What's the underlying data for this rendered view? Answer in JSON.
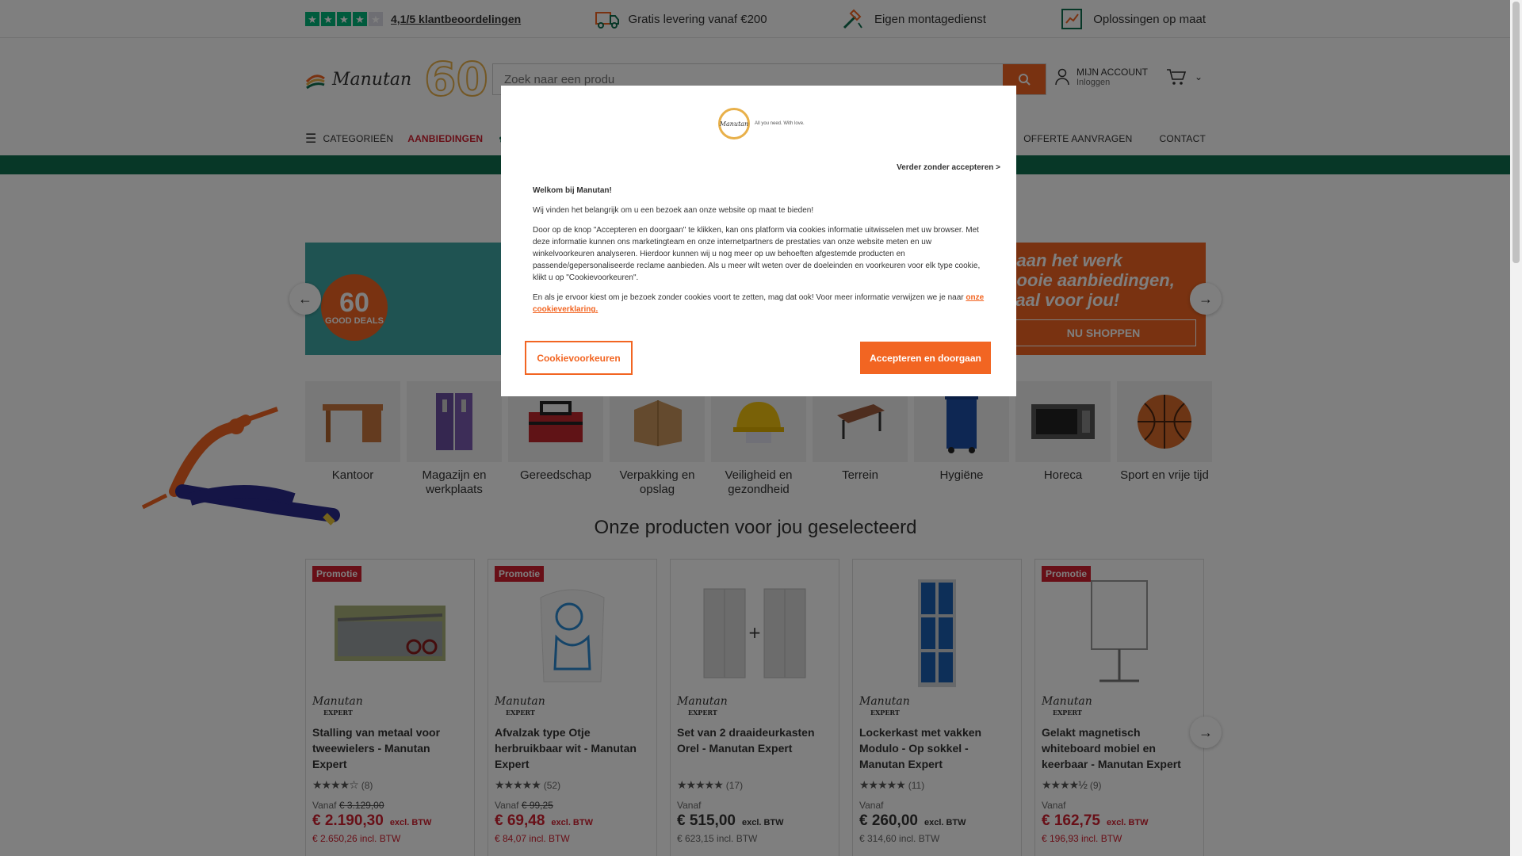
{
  "topbar": {
    "rating_text": "4,1/5 klantbeoordelingen",
    "rating_value": 4.1,
    "usp_delivery": "Gratis levering vanaf €200",
    "usp_assembly": "Eigen montagedienst",
    "usp_solutions": "Oplossingen op maat"
  },
  "header": {
    "logo_word": "Manutan",
    "logo_number": "60",
    "search_placeholder": "Zoek naar een produ",
    "account_label": "MIJN ACCOUNT",
    "account_sub": "Inloggen"
  },
  "nav": {
    "categories": "CATEGORIEËN",
    "offers": "AANBIEDINGEN",
    "quote": "OFFERTE AANVRAGEN",
    "contact": "CONTACT"
  },
  "hero": {
    "badge_number": "60",
    "badge_text": "GOOD DEALS",
    "title_line1": "g aan het werk",
    "title_line2": "mooie aanbiedingen,",
    "title_line3": "ciaal voor jou!",
    "cta": "NU SHOPPEN"
  },
  "categories": [
    {
      "label": "Kantoor",
      "icon": "desk-icon"
    },
    {
      "label": "Magazijn en werkplaats",
      "icon": "locker-icon"
    },
    {
      "label": "Gereedschap",
      "icon": "toolbox-icon"
    },
    {
      "label": "Verpakking en opslag",
      "icon": "box-icon"
    },
    {
      "label": "Veiligheid en gezondheid",
      "icon": "helmet-icon"
    },
    {
      "label": "Terrein",
      "icon": "bench-icon"
    },
    {
      "label": "Hygiëne",
      "icon": "bin-icon"
    },
    {
      "label": "Horeca",
      "icon": "microwave-icon"
    },
    {
      "label": "Sport en vrije tijd",
      "icon": "basketball-icon"
    }
  ],
  "section_title": "Onze producten voor jou geselecteerd",
  "products": [
    {
      "promo": "Promotie",
      "brand": "Manutan",
      "brand_sub": "EXPERT",
      "name": "Stalling van metaal voor tweewielers - Manutan Expert",
      "stars": 4,
      "reviews": "(8)",
      "vanaf": "Vanaf",
      "old_price": "€ 3.129,00",
      "price": "€ 2.190,30",
      "excl": "excl. BTW",
      "incl": "€ 2.650,26 incl. BTW"
    },
    {
      "promo": "Promotie",
      "brand": "Manutan",
      "brand_sub": "EXPERT",
      "name": "Afvalzak type Otje herbruikbaar wit - Manutan Expert",
      "stars": 5,
      "reviews": "(52)",
      "vanaf": "Vanaf",
      "old_price": "€ 99,25",
      "price": "€ 69,48",
      "excl": "excl. BTW",
      "incl": "€ 84,07 incl. BTW"
    },
    {
      "promo": "",
      "brand": "Manutan",
      "brand_sub": "EXPERT",
      "name": "Set van 2 draaideurkasten Orel - Manutan Expert",
      "stars": 5,
      "reviews": "(17)",
      "vanaf": "Vanaf",
      "old_price": "",
      "price": "€ 515,00",
      "excl": "excl. BTW",
      "incl": "€ 623,15 incl. BTW"
    },
    {
      "promo": "",
      "brand": "Manutan",
      "brand_sub": "EXPERT",
      "name": "Lockerkast met vakken Modulo - Op sokkel - Manutan Expert",
      "stars": 5,
      "reviews": "(11)",
      "vanaf": "Vanaf",
      "old_price": "",
      "price": "€ 260,00",
      "excl": "excl. BTW",
      "incl": "€ 314,60 incl. BTW"
    },
    {
      "promo": "Promotie",
      "brand": "Manutan",
      "brand_sub": "EXPERT",
      "name": "Gelakt magnetisch whiteboard mobiel en keerbaar - Manutan Expert",
      "stars": 4.5,
      "reviews": "(9)",
      "vanaf": "Vanaf",
      "old_price": "",
      "price": "€ 162,75",
      "excl": "excl. BTW",
      "incl": "€ 196,93 incl. BTW"
    }
  ],
  "cookie_modal": {
    "logo_word": "Manutan",
    "logo_tag": "All you need. With love.",
    "skip": "Verder zonder accepteren >",
    "welcome": "Welkom bij Manutan!",
    "p1": "Wij vinden het belangrijk om u een bezoek aan onze website op maat te bieden!",
    "p2": "Door op de knop \"Accepteren en doorgaan\" te klikken, kan ons platform via cookies informatie uitwisselen met uw browser. Met deze informatie kunnen ons marketingteam en onze internetpartners de prestaties van onze website meten en uw winkelvoorkeuren analyseren. Hierdoor kunnen wij u nog meer op uw behoeften afgestemde producten en passende/gepersonaliseerde reclame aanbieden. Als u meer wilt weten over de doeleinden en voorkeuren voor elk type cookie, klikt u op \"Cookievoorkeuren\".",
    "p3": "En als je ervoor kiest om je bezoek zonder cookies voort te zetten, mag dat ook! Voor meer informatie verwijzen we je naar",
    "link": "onze cookieverklaring.",
    "btn_prefs": "Cookievoorkeuren",
    "btn_accept": "Accepteren en doorgaan"
  },
  "colors": {
    "accent": "#f26522",
    "promo_red": "#d01f2f",
    "trustpilot": "#00b67a",
    "green_bar": "#0f6e4f"
  }
}
